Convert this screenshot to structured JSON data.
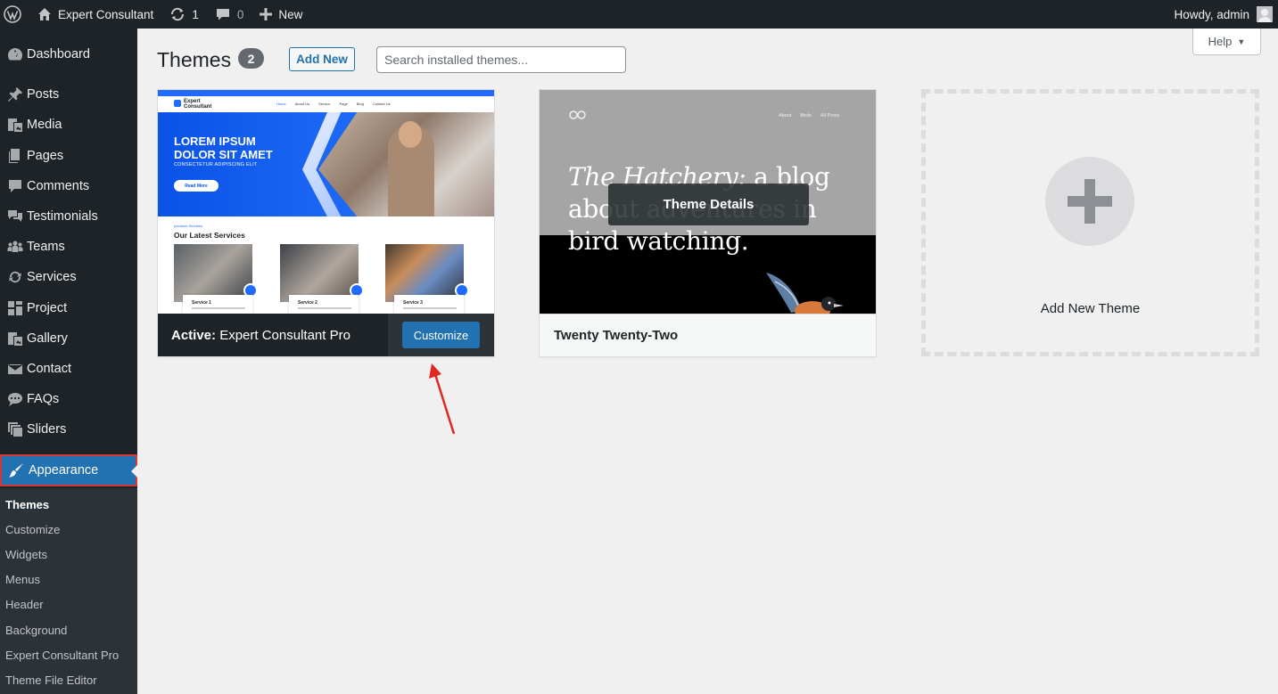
{
  "admin_bar": {
    "site_name": "Expert Consultant",
    "updates_count": "1",
    "comments_count": "0",
    "new_label": "New",
    "greeting": "Howdy, admin"
  },
  "sidebar": {
    "items": [
      {
        "label": "Dashboard",
        "icon": "dashboard-icon"
      },
      {
        "label": "Posts",
        "icon": "pin-icon"
      },
      {
        "label": "Media",
        "icon": "media-icon"
      },
      {
        "label": "Pages",
        "icon": "pages-icon"
      },
      {
        "label": "Comments",
        "icon": "comment-icon"
      },
      {
        "label": "Testimonials",
        "icon": "testimonial-icon"
      },
      {
        "label": "Teams",
        "icon": "groups-icon"
      },
      {
        "label": "Services",
        "icon": "update-icon"
      },
      {
        "label": "Project",
        "icon": "portfolio-icon"
      },
      {
        "label": "Gallery",
        "icon": "gallery-icon"
      },
      {
        "label": "Contact",
        "icon": "email-icon"
      },
      {
        "label": "FAQs",
        "icon": "chat-icon"
      },
      {
        "label": "Sliders",
        "icon": "slides-icon"
      },
      {
        "label": "Appearance",
        "icon": "brush-icon"
      }
    ],
    "submenu": [
      "Themes",
      "Customize",
      "Widgets",
      "Menus",
      "Header",
      "Background",
      "Expert Consultant Pro",
      "Theme File Editor"
    ]
  },
  "main": {
    "help_label": "Help",
    "title": "Themes",
    "count": "2",
    "add_new_label": "Add New",
    "search_placeholder": "Search installed themes...",
    "active_theme": {
      "prefix": "Active:",
      "name": "Expert Consultant Pro",
      "customize_label": "Customize",
      "screenshot": {
        "logo_line1": "Expert",
        "logo_line2": "Consultant",
        "nav": [
          "Home",
          "About Us",
          "Service",
          "Page",
          "Blog",
          "Contact Us"
        ],
        "hero_line1": "LOREM IPSUM",
        "hero_line2": "DOLOR SIT AMET",
        "hero_sub": "CONSECTETUR ADIPISCING ELIT",
        "hero_button": "Read More",
        "services_small": "premium Services",
        "services_title": "Our Latest Services",
        "services": [
          "Service 1",
          "Service 2",
          "Service 3"
        ]
      }
    },
    "second_theme": {
      "name": "Twenty Twenty-Two",
      "details_label": "Theme Details",
      "screenshot": {
        "nav": [
          "About",
          "Birds",
          "All Posts"
        ],
        "headline_italic": "The Hatchery:",
        "headline_rest": " a blog about adventures in bird watching."
      }
    },
    "add_new_theme_label": "Add New Theme"
  },
  "colors": {
    "admin_dark": "#1d2327",
    "accent_blue": "#2271b1",
    "highlight_red": "#d63638",
    "page_bg": "#f0f0f1"
  }
}
